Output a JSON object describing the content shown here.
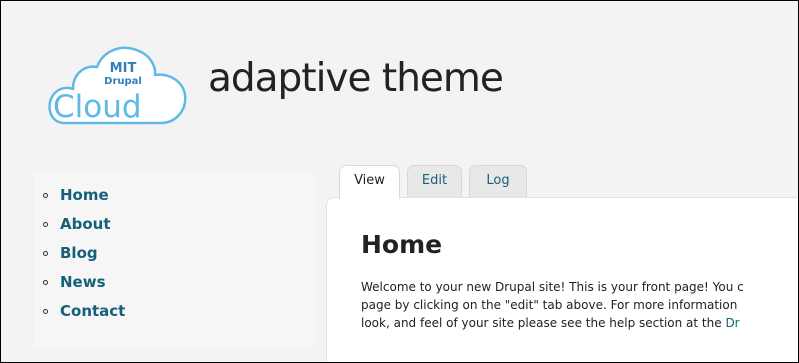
{
  "header": {
    "logo": {
      "line1": "MIT",
      "line2": "Drupal",
      "line3": "Cloud"
    },
    "site_name": "adaptive theme"
  },
  "sidebar": {
    "items": [
      {
        "label": "Home"
      },
      {
        "label": "About"
      },
      {
        "label": "Blog"
      },
      {
        "label": "News"
      },
      {
        "label": "Contact"
      }
    ]
  },
  "tabs": [
    {
      "label": "View"
    },
    {
      "label": "Edit"
    },
    {
      "label": "Log"
    }
  ],
  "content": {
    "title": "Home",
    "line1": "Welcome to your new Drupal site! This is your front page! You c",
    "line2": "page by clicking on the \"edit\" tab above. For more information",
    "line3_text": "look, and feel of your site please see the help section at the ",
    "line3_link": "Dr"
  },
  "colors": {
    "link": "#16607a",
    "logo_blue": "#5fb8e6",
    "background": "#f3f3f3"
  }
}
